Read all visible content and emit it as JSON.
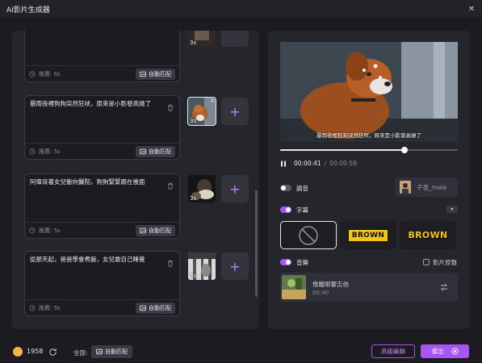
{
  "window": {
    "title": "AI影片生成器",
    "close_glyph": "✕"
  },
  "scenes": [
    {
      "text": "",
      "duration": "推薦: 6s",
      "match_label": "自動匹配",
      "thumb_duration": "3s"
    },
    {
      "text": "暴雨夜裡狗狗突然狂吠，原來是小影發高燒了",
      "duration": "推薦: 5s",
      "match_label": "自動匹配",
      "thumb_duration": "3s"
    },
    {
      "text": "阿偉背著女兒衝向醫院，狗狗緊緊跟在後面",
      "duration": "推薦: 5s",
      "match_label": "自動匹配",
      "thumb_duration": "3s"
    },
    {
      "text": "從那天起，爸爸學會煮飯，女兒敢自己睡覺",
      "duration": "推薦: 5s",
      "match_label": "自動匹配",
      "thumb_duration": "3s"
    }
  ],
  "player": {
    "subtitle": "暴雨夜裡狗狗突然狂吠，原來是小影發高燒了",
    "current_time": "00:00:41",
    "separator": "/",
    "total_time": "00:00:58",
    "progress": 0.7
  },
  "voice": {
    "label": "語音",
    "enabled": false,
    "voice_name": "子墨_male"
  },
  "subtitles": {
    "label": "字幕",
    "enabled": true,
    "styles": [
      {
        "name": "none",
        "selected": true
      },
      {
        "name": "BROWN",
        "selected": false
      },
      {
        "name": "BROWN",
        "selected": false
      }
    ]
  },
  "music": {
    "label": "音樂",
    "enabled": true,
    "original_sound_label": "影片原聲",
    "track_name": "傷離眼饗吉他",
    "track_duration": "00:40"
  },
  "footer": {
    "coins": "1958",
    "all_label": "全部:",
    "auto_match_label": "自動匹配",
    "advanced_edit_label": "高級編輯",
    "export_label": "導出"
  },
  "colors": {
    "accent": "#a855f7",
    "brown_yellow": "#f5c518",
    "panel": "#25252c",
    "background": "#1b1b20"
  }
}
